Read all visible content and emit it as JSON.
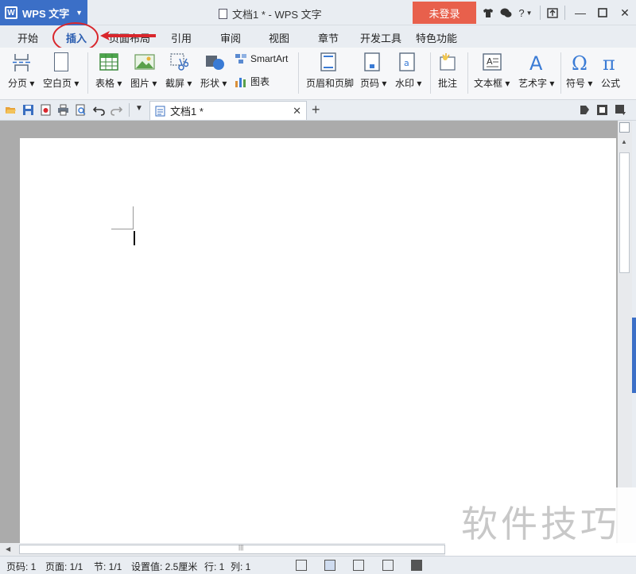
{
  "titlebar": {
    "app_name": "WPS 文字",
    "doc_title": "文档1 * - WPS 文字",
    "login_label": "未登录",
    "help_label": "?"
  },
  "menu": {
    "tabs": [
      "开始",
      "插入",
      "页面布局",
      "引用",
      "审阅",
      "视图",
      "章节",
      "开发工具",
      "特色功能"
    ],
    "active_tab": "插入"
  },
  "ribbon": {
    "page_break": "分页",
    "blank_page": "空白页",
    "table": "表格",
    "picture": "图片",
    "screenshot": "截屏",
    "shape": "形状",
    "smartart": "SmartArt",
    "chart": "图表",
    "header_footer": "页眉和页脚",
    "page_number": "页码",
    "watermark": "水印",
    "comment": "批注",
    "textbox": "文本框",
    "wordart": "艺术字",
    "symbol": "符号",
    "formula": "公式"
  },
  "document_tab": {
    "label": "文档1 *"
  },
  "status": {
    "page": "页码: 1",
    "pages": "页面: 1/1",
    "section": "节: 1/1",
    "setting": "设置值: 2.5厘米",
    "row": "行: 1",
    "col": "列: 1"
  },
  "overlay": {
    "watermark_text": "软件技巧"
  },
  "colors": {
    "app_blue": "#3b6fc7",
    "login_red": "#e8604c",
    "annotation_red": "#d9262c"
  },
  "icons": [
    "wps-logo-icon",
    "tshirt-icon",
    "chat-icon",
    "help-icon",
    "minimize-icon",
    "maximize-icon",
    "close-icon",
    "open-folder-icon",
    "save-icon",
    "print-icon",
    "undo-icon",
    "redo-icon"
  ]
}
